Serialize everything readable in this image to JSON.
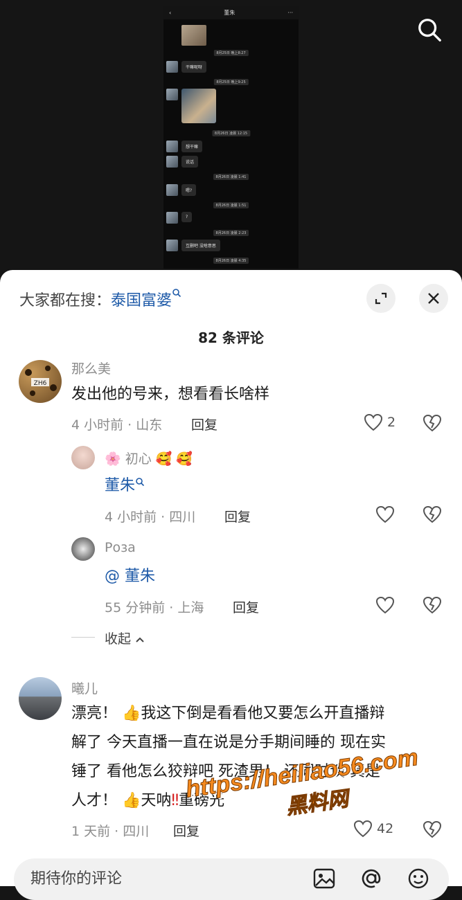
{
  "screenshot": {
    "phone_title": "董朱",
    "phone_menu": "···",
    "timestamps": [
      "8月25日 晚上8:27",
      "8月25日 晚上9:25",
      "8月26日 凌晨 12:15",
      "8月26日 凌晨 1:41",
      "8月26日 凌晨 1:51",
      "8月26日 凌晨 2:23",
      "8月26日 凌晨 4:35"
    ],
    "messages": [
      "干嘛呢呀",
      "想干嘛",
      "说话",
      "嗯?",
      "?",
      "互删吧 没啥意思"
    ]
  },
  "search": {
    "label": "大家都在搜：",
    "keyword": "泰国富婆"
  },
  "comments_count": "82 条评论",
  "comments": [
    {
      "name": "那么美",
      "text": "发出他的号来，想看看长啥样",
      "meta": "4 小时前 · 山东",
      "reply": "回复",
      "likes": "2"
    },
    {
      "name": "🌸 初心 🥰 🥰",
      "text": "董朱",
      "meta": "4 小时前 · 四川",
      "reply": "回复"
    },
    {
      "name": "Роза",
      "text": "@ 董朱",
      "meta": "55 分钟前 · 上海",
      "reply": "回复"
    },
    {
      "name": "曦儿",
      "text_line1": "漂亮！",
      "text_line1b": "我这下倒是看看他又要怎么开直播辩",
      "text_line2": "解了 今天直播一直在说是分手期间睡的 现在实",
      "text_line3": "锤了 看他怎么狡辩吧 死渣男！ 还同时谈 真",
      "text_line3b": "是",
      "text_line4a": "人才！",
      "text_line4b": "天呐",
      "text_line4c": "重磅",
      "text_line4d": "光",
      "meta": "1 天前 · 四川",
      "reply": "回复",
      "likes": "42"
    }
  ],
  "collapse_label": "收起",
  "input_placeholder": "期待你的评论",
  "watermark": {
    "url": "https://heiliao56.com",
    "cn": "黑料网"
  }
}
